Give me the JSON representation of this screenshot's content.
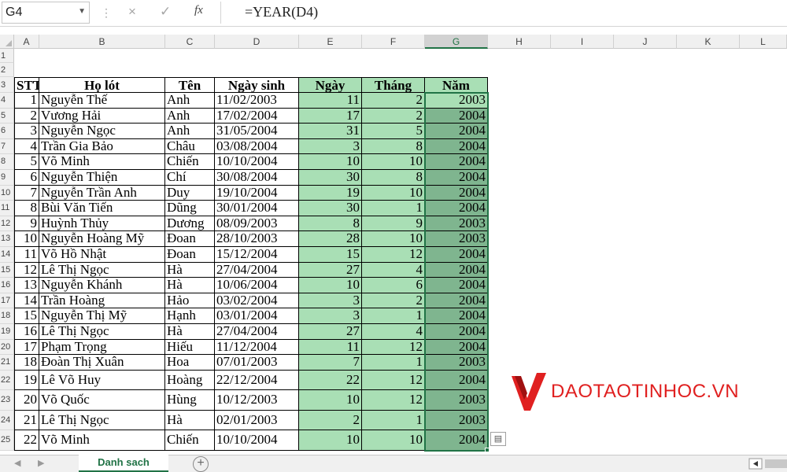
{
  "formula_bar": {
    "name_box": "G4",
    "fx_label": "fx",
    "formula": "=YEAR(D4)",
    "cancel_icon": "×",
    "enter_icon": "✓"
  },
  "columns": [
    "A",
    "B",
    "C",
    "D",
    "E",
    "F",
    "G",
    "H",
    "I",
    "J",
    "K",
    "L"
  ],
  "selected_column": "G",
  "rows": [
    "1",
    "2",
    "3",
    "4",
    "5",
    "6",
    "7",
    "8",
    "9",
    "10",
    "11",
    "12",
    "13",
    "14",
    "15",
    "16",
    "17",
    "18",
    "19",
    "20",
    "21",
    "22",
    "23",
    "24",
    "25"
  ],
  "headers": {
    "stt": "STT",
    "holot": "Họ lót",
    "ten": "Tên",
    "ngaysinh": "Ngày sinh",
    "ngay": "Ngày",
    "thang": "Tháng",
    "nam": "Năm"
  },
  "table": [
    [
      "1",
      "Nguyễn Thế",
      "Anh",
      "11/02/2003",
      "11",
      "2",
      "2003"
    ],
    [
      "2",
      "Vương Hải",
      "Anh",
      "17/02/2004",
      "17",
      "2",
      "2004"
    ],
    [
      "3",
      "Nguyễn Ngọc",
      "Anh",
      "31/05/2004",
      "31",
      "5",
      "2004"
    ],
    [
      "4",
      "Trần Gia Bảo",
      "Châu",
      "03/08/2004",
      "3",
      "8",
      "2004"
    ],
    [
      "5",
      "Võ Minh",
      "Chiến",
      "10/10/2004",
      "10",
      "10",
      "2004"
    ],
    [
      "6",
      "Nguyễn Thiện",
      "Chí",
      "30/08/2004",
      "30",
      "8",
      "2004"
    ],
    [
      "7",
      "Nguyễn Trần Anh",
      "Duy",
      "19/10/2004",
      "19",
      "10",
      "2004"
    ],
    [
      "8",
      "Bùi Văn Tiến",
      "Dũng",
      "30/01/2004",
      "30",
      "1",
      "2004"
    ],
    [
      "9",
      "Huỳnh Thủy",
      "Dương",
      "08/09/2003",
      "8",
      "9",
      "2003"
    ],
    [
      "10",
      "Nguyễn Hoàng Mỹ",
      "Đoan",
      "28/10/2003",
      "28",
      "10",
      "2003"
    ],
    [
      "11",
      "Võ Hồ Nhật",
      "Đoan",
      "15/12/2004",
      "15",
      "12",
      "2004"
    ],
    [
      "12",
      "Lê Thị Ngọc",
      "Hà",
      "27/04/2004",
      "27",
      "4",
      "2004"
    ],
    [
      "13",
      "Nguyễn Khánh",
      "Hà",
      "10/06/2004",
      "10",
      "6",
      "2004"
    ],
    [
      "14",
      "Trần Hoàng",
      "Hảo",
      "03/02/2004",
      "3",
      "2",
      "2004"
    ],
    [
      "15",
      "Nguyễn Thị Mỹ",
      "Hạnh",
      "03/01/2004",
      "3",
      "1",
      "2004"
    ],
    [
      "16",
      "Lê Thị Ngọc",
      "Hà",
      "27/04/2004",
      "27",
      "4",
      "2004"
    ],
    [
      "17",
      "Phạm Trọng",
      "Hiếu",
      "11/12/2004",
      "11",
      "12",
      "2004"
    ],
    [
      "18",
      "Đoàn Thị Xuân",
      "Hoa",
      "07/01/2003",
      "7",
      "1",
      "2003"
    ],
    [
      "19",
      "Lê Võ Huy",
      "Hoàng",
      "22/12/2004",
      "22",
      "12",
      "2004"
    ],
    [
      "20",
      "Võ Quốc",
      "Hùng",
      "10/12/2003",
      "10",
      "12",
      "2003"
    ],
    [
      "21",
      "Lê Thị Ngọc",
      "Hà",
      "02/01/2003",
      "2",
      "1",
      "2003"
    ],
    [
      "22",
      "Võ Minh",
      "Chiến",
      "10/10/2004",
      "10",
      "10",
      "2004"
    ]
  ],
  "watermark": {
    "text": "DAOTAOTINHOC.VN",
    "color": "#e02020"
  },
  "sheet_tabs": {
    "active": "Danh sach",
    "add_icon": "+"
  },
  "colors": {
    "accent": "#217346",
    "fill_green": "#a9dfb5",
    "fill_selected": "#7fb58f"
  }
}
